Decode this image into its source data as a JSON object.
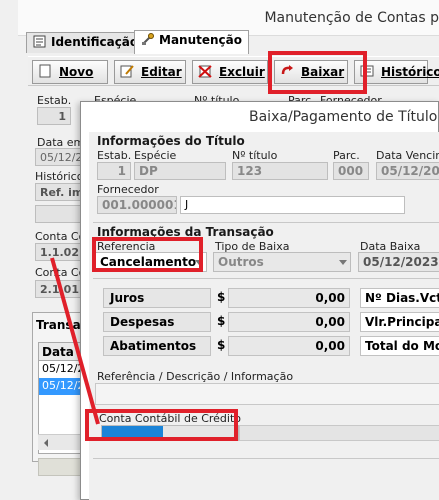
{
  "parent_window": {
    "title": "Manutenção de Contas p",
    "tabs": [
      {
        "label": "Identificação",
        "icon": "document-icon"
      },
      {
        "label": "Manutenção",
        "icon": "tools-icon"
      }
    ],
    "toolbar": [
      {
        "label": "Novo",
        "icon": "new-icon"
      },
      {
        "label": "Editar",
        "icon": "edit-icon"
      },
      {
        "label": "Excluir",
        "icon": "delete-icon"
      },
      {
        "label": "Baixar",
        "icon": "undo-arrow-icon"
      },
      {
        "label": "Histórico",
        "icon": "history-icon"
      }
    ],
    "fields": {
      "estab_label": "Estab.",
      "especie_label": "Espécie",
      "titulo_label": "Nº título",
      "parc_label": "Parc.",
      "fornecedor_label": "Fornecedor",
      "estab_value": "1",
      "data_emissao_label": "Data emis",
      "data_emissao_value": "05/12/2",
      "historico_label": "Histórico/",
      "ref_value": "Ref. imp",
      "conta_co_label_1": "Conta Co",
      "conta_co_value_1": "1.1.02.",
      "conta_co_label_2": "Conta Co",
      "conta_co_value_2": "2.1.01."
    },
    "transactions": {
      "tab_label": "Transa",
      "column": "Data",
      "rows": [
        "05/12/2",
        "05/12/2"
      ]
    }
  },
  "dialog": {
    "title": "Baixa/Pagamento de Título",
    "titulo_section": "Informações do Título",
    "labels": {
      "estab": "Estab.",
      "especie": "Espécie",
      "titulo": "Nº título",
      "parc": "Parc.",
      "vencimento": "Data Vencime",
      "fornecedor": "Fornecedor"
    },
    "values": {
      "estab": "1",
      "especie": "DP",
      "titulo": "123",
      "parc": "000",
      "vencimento": "05/12/2023",
      "fornecedor_code": "001.000001",
      "fornecedor_name": "J"
    },
    "transacao_section": "Informações da Transação",
    "referencia_label": "Referencia",
    "referencia_value": "Cancelamento",
    "tipo_baixa_label": "Tipo de Baixa",
    "tipo_baixa_value": "Outros",
    "data_baixa_label": "Data Baixa",
    "data_baixa_value": "05/12/2023",
    "amounts": [
      {
        "label": "Juros",
        "currency": "$",
        "value": "0,00"
      },
      {
        "label": "Despesas",
        "currency": "$",
        "value": "0,00"
      },
      {
        "label": "Abatimentos",
        "currency": "$",
        "value": "0,00"
      }
    ],
    "right_labels": [
      "Nº Dias.Vcto.",
      "Vlr.Principal",
      "Total do Mov"
    ],
    "ref_desc_label": "Referência / Descrição / Informação",
    "conta_credito_label": "Conta Contábil de Crédito",
    "conta_credito_fill": 0.45
  },
  "colors": {
    "annotation": "#e0202a",
    "selection": "#3399ff",
    "progress": "#1b84d8"
  }
}
